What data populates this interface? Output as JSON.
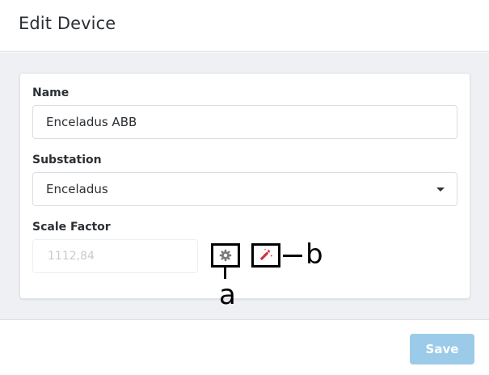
{
  "dialog": {
    "title": "Edit Device"
  },
  "form": {
    "name_label": "Name",
    "name_value": "Enceladus ABB",
    "substation_label": "Substation",
    "substation_value": "Enceladus",
    "scale_label": "Scale Factor",
    "scale_placeholder": "1112,84"
  },
  "annotations": {
    "a": "a",
    "b": "b"
  },
  "icons": {
    "settings": "gear-icon",
    "wand": "magic-wand-icon"
  },
  "colors": {
    "save_button": "#9ccbea",
    "wand_icon": "#d0333f",
    "gear_icon": "#7a7a7a"
  },
  "footer": {
    "save_label": "Save"
  }
}
